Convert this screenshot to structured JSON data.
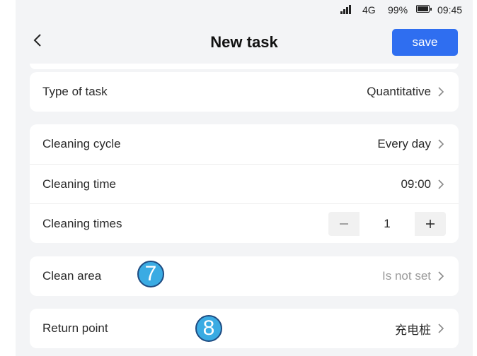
{
  "status_bar": {
    "network": "4G",
    "battery": "99%",
    "time": "09:45"
  },
  "header": {
    "title": "New task",
    "save_label": "save"
  },
  "task_type": {
    "label": "Type of task",
    "value": "Quantitative"
  },
  "schedule": {
    "cycle_label": "Cleaning cycle",
    "cycle_value": "Every day",
    "time_label": "Cleaning time",
    "time_value": "09:00",
    "times_label": "Cleaning times",
    "times_value": "1",
    "minus": "−",
    "plus": "+"
  },
  "area": {
    "label": "Clean area",
    "value": "Is not set"
  },
  "return_point": {
    "label": "Return point",
    "value": "充电桩"
  },
  "annotations": {
    "area_marker": "7",
    "return_marker": "8"
  },
  "colors": {
    "accent": "#2f6ef0",
    "callout_fill": "#3aabe3",
    "callout_border": "#1f4c82",
    "background": "#f3f4f6"
  }
}
